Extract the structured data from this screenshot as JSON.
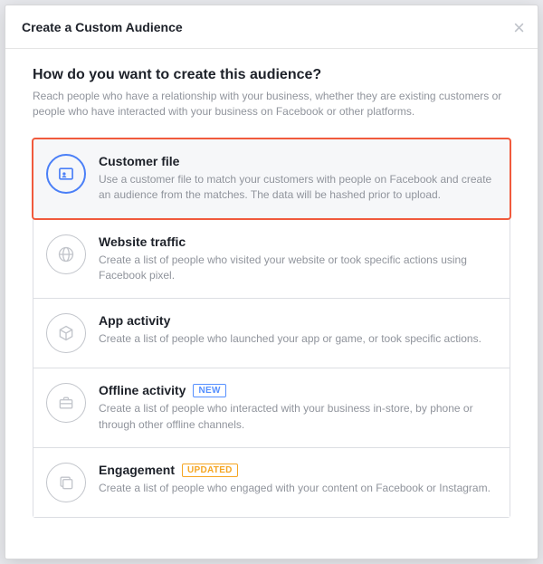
{
  "header": {
    "title": "Create a Custom Audience"
  },
  "intro": {
    "subtitle": "How do you want to create this audience?",
    "subtext": "Reach people who have a relationship with your business, whether they are existing customers or people who have interacted with your business on Facebook or other platforms."
  },
  "options": {
    "customer_file": {
      "title": "Customer file",
      "desc": "Use a customer file to match your customers with people on Facebook and create an audience from the matches. The data will be hashed prior to upload."
    },
    "website_traffic": {
      "title": "Website traffic",
      "desc": "Create a list of people who visited your website or took specific actions using Facebook pixel."
    },
    "app_activity": {
      "title": "App activity",
      "desc": "Create a list of people who launched your app or game, or took specific actions."
    },
    "offline_activity": {
      "title": "Offline activity",
      "badge": "NEW",
      "desc": "Create a list of people who interacted with your business in-store, by phone or through other offline channels."
    },
    "engagement": {
      "title": "Engagement",
      "badge": "UPDATED",
      "desc": "Create a list of people who engaged with your content on Facebook or Instagram."
    }
  }
}
